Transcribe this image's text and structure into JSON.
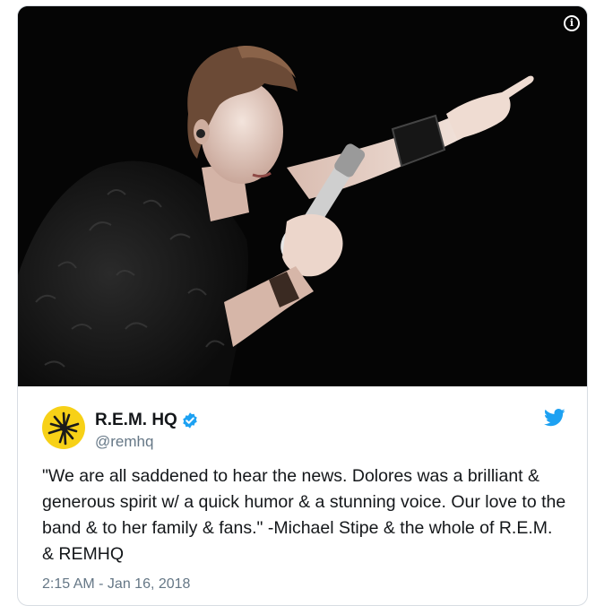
{
  "tweet": {
    "author": {
      "display_name": "R.E.M. HQ",
      "handle": "@remhq",
      "verified": true
    },
    "text": "\"We are all saddened to hear the news. Dolores was a brilliant & generous spirit w/ a quick humor & a stunning voice. Our love to the band & to her family & fans.\" -Michael Stipe & the whole of R.E.M. & REMHQ",
    "timestamp": "2:15 AM - Jan 16, 2018",
    "media": {
      "type": "photo",
      "icon": "info-icon"
    }
  },
  "icons": {
    "info": "info-icon",
    "verified": "verified-badge-icon",
    "brand": "twitter-bird-icon",
    "avatar_logo": "rem-star-logo"
  },
  "colors": {
    "brand_blue": "#1da1f2",
    "text_primary": "#14171a",
    "text_secondary": "#657786",
    "avatar_yellow": "#f7d117"
  }
}
